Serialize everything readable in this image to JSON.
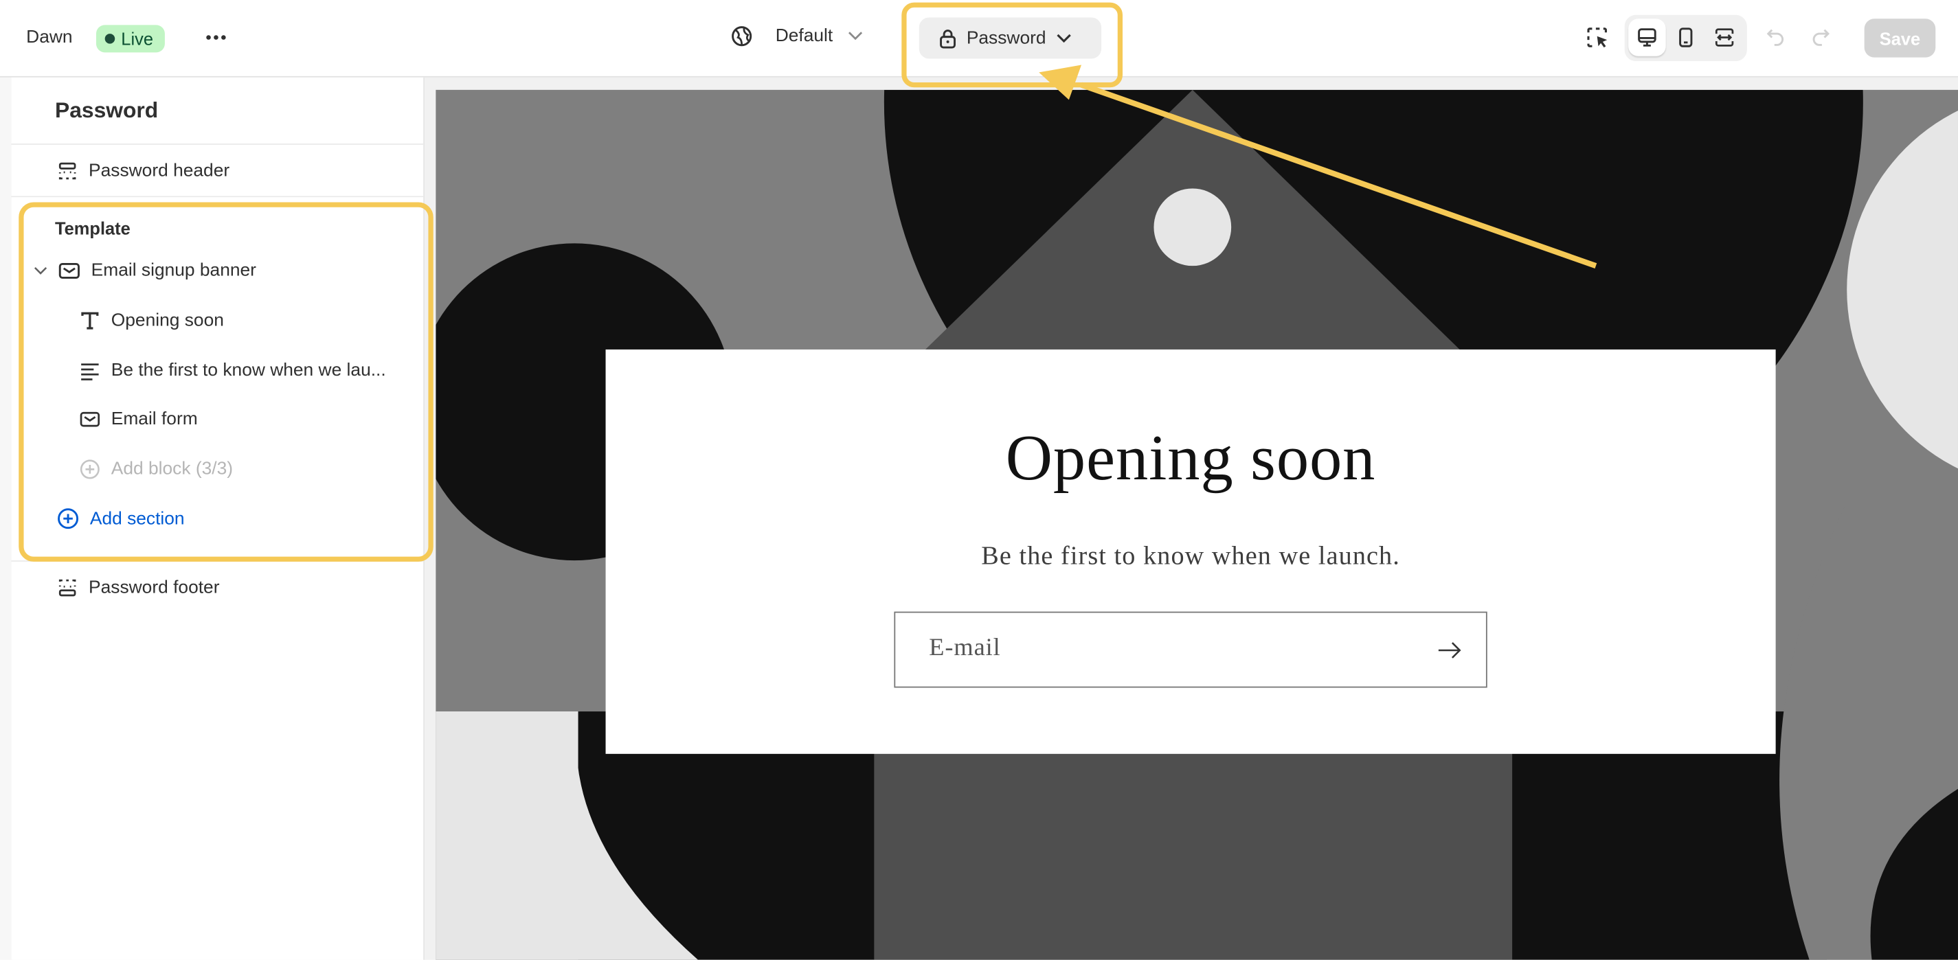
{
  "topbar": {
    "store_name": "Dawn",
    "status_badge": "Live",
    "more_icon": "more-horizontal-icon",
    "locale_label": "Default",
    "template_selector": "Password",
    "save_label": "Save"
  },
  "sidebar": {
    "title": "Password",
    "header_section": "Password header",
    "template_label": "Template",
    "section": "Email signup banner",
    "blocks": [
      {
        "label": "Opening soon",
        "icon": "text-icon"
      },
      {
        "label": "Be the first to know when we lau...",
        "icon": "paragraph-icon"
      },
      {
        "label": "Email form",
        "icon": "email-icon"
      }
    ],
    "add_block": "Add block (3/3)",
    "add_section": "Add section",
    "footer_section": "Password footer"
  },
  "preview": {
    "heading": "Opening soon",
    "subheading": "Be the first to know when we launch.",
    "email_placeholder": "E-mail"
  },
  "colors": {
    "highlight": "#f5c956",
    "live_bg": "#c1f5c4",
    "link": "#005bd3",
    "save_disabled": "#d4d4d4"
  }
}
